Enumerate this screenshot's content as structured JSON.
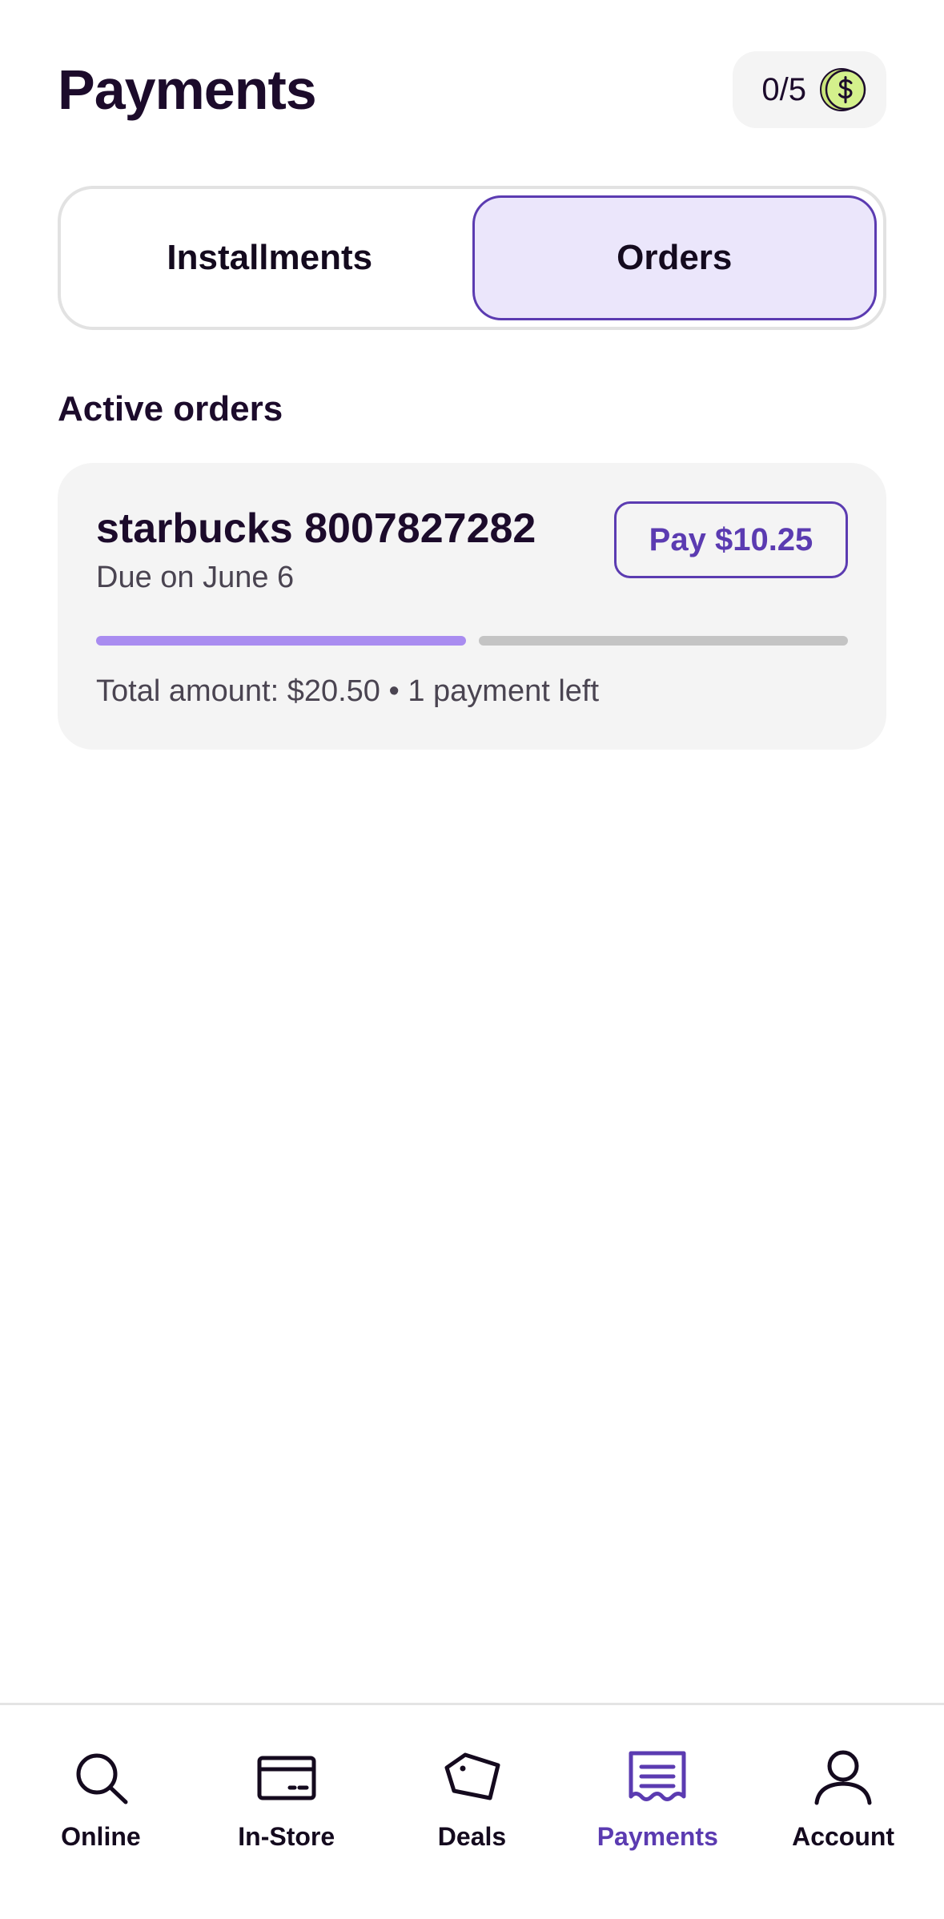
{
  "header": {
    "title": "Payments",
    "rewards_count": "0/5",
    "rewards_icon": "dollar-coin-icon"
  },
  "tabs": [
    {
      "label": "Installments",
      "active": false
    },
    {
      "label": "Orders",
      "active": true
    }
  ],
  "section": {
    "title": "Active orders"
  },
  "order": {
    "merchant": "starbucks 8007827282",
    "due": "Due on June 6",
    "pay_label": "Pay $10.25",
    "payments_total": 2,
    "payments_paid": 1,
    "summary": "Total amount: $20.50 • 1 payment left"
  },
  "nav": [
    {
      "label": "Online",
      "icon": "search-icon",
      "active": false
    },
    {
      "label": "In-Store",
      "icon": "card-icon",
      "active": false
    },
    {
      "label": "Deals",
      "icon": "tag-icon",
      "active": false
    },
    {
      "label": "Payments",
      "icon": "receipt-icon",
      "active": true
    },
    {
      "label": "Account",
      "icon": "person-icon",
      "active": false
    }
  ],
  "colors": {
    "accent": "#5b3bb1",
    "progress_paid": "#a98cf0",
    "progress_remaining": "#c4c4c4",
    "active_tab_bg": "#ebe6fb",
    "coin": "#d4f08c"
  }
}
